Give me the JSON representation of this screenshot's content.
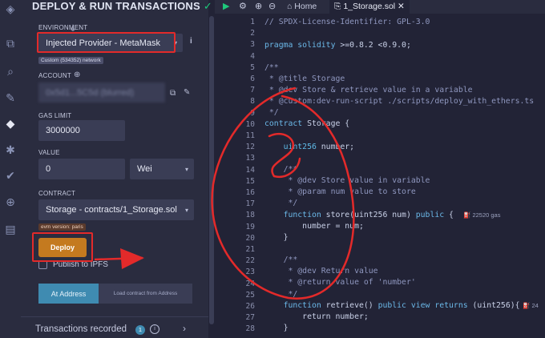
{
  "panel": {
    "title": "DEPLOY & RUN TRANSACTIONS",
    "environment": {
      "label": "ENVIRONMENT",
      "value": "Injected Provider - MetaMask",
      "network_badge": "Custom (534352) network"
    },
    "account": {
      "label": "ACCOUNT",
      "value": "0x5d1...5C5d (blurred)"
    },
    "gas_limit": {
      "label": "GAS LIMIT",
      "value": "3000000"
    },
    "value": {
      "label": "VALUE",
      "amount": "0",
      "unit": "Wei"
    },
    "contract": {
      "label": "CONTRACT",
      "value": "Storage - contracts/1_Storage.sol",
      "evm_badge": "evm version: paris"
    },
    "deploy_label": "Deploy",
    "publish_label": "Publish to IPFS",
    "at_address_label": "At Address",
    "load_contract_placeholder": "Load contract from Address",
    "transactions_label": "Transactions recorded",
    "transactions_count": "1"
  },
  "editor": {
    "home_tab": "Home",
    "file_tab": "1_Storage.sol",
    "lines": [
      "1",
      "2",
      "3",
      "4",
      "5",
      "6",
      "7",
      "8",
      "9",
      "10",
      "11",
      "12",
      "13",
      "14",
      "15",
      "16",
      "17",
      "18",
      "19",
      "20",
      "21",
      "22",
      "23",
      "24",
      "25",
      "26",
      "27",
      "28"
    ],
    "code": {
      "l1": "// SPDX-License-Identifier: GPL-3.0",
      "l3a": "pragma solidity ",
      "l3b": ">=0.8.2 <0.9.0;",
      "l5": "/**",
      "l6": " * @title Storage",
      "l7": " * @dev Store & retrieve value in a variable",
      "l8": " * @custom:dev-run-script ./scripts/deploy_with_ethers.ts",
      "l9": " */",
      "l10a": "contract",
      "l10b": " Storage {",
      "l12a": "    uint256",
      "l12b": " number;",
      "l14": "    /**",
      "l15": "     * @dev Store value in variable",
      "l16": "     * @param num value to store",
      "l17": "     */",
      "l18a": "    function",
      "l18b": " store(uint256 num) ",
      "l18c": "public",
      "l18d": " {",
      "l19": "        number = num;",
      "l20": "    }",
      "l22": "    /**",
      "l23": "     * @dev Return value",
      "l24": "     * @return value of 'number'",
      "l25": "     */",
      "l26a": "    function",
      "l26b": " retrieve() ",
      "l26c": "public view returns",
      "l26d": " (uint256){",
      "l27": "        return number;",
      "l28": "    }"
    },
    "gas_store": "22520 gas",
    "gas_retrieve": "24"
  },
  "colors": {
    "background": "#222336",
    "panel": "#2a2c3f",
    "field": "#3a3d55",
    "deploy": "#c47a1f",
    "at_address": "#3f8bb1",
    "annotation_red": "#e32a2a"
  }
}
